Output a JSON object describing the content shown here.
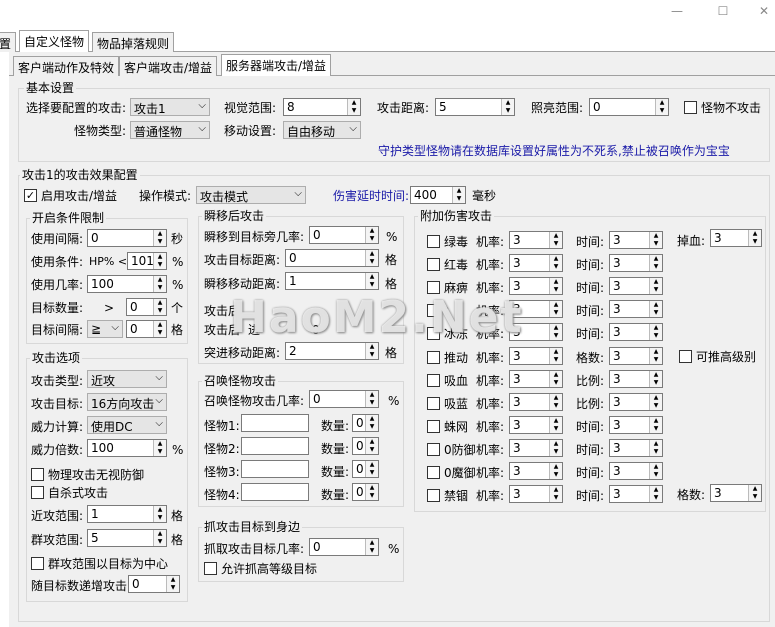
{
  "window": {
    "minimize": "—",
    "maximize": "☐",
    "close": "✕"
  },
  "top_tabs": [
    "置",
    "自定义怪物",
    "物品掉落规则"
  ],
  "sub_tabs": [
    "客户端动作及特效",
    "客户端攻击/增益",
    "服务器端攻击/增益"
  ],
  "basic": {
    "title": "基本设置",
    "select_attack_label": "选择要配置的攻击:",
    "select_attack_value": "攻击1",
    "view_range_label": "视觉范围:",
    "view_range_value": "8",
    "attack_dist_label": "攻击距离:",
    "attack_dist_value": "5",
    "light_range_label": "照亮范围:",
    "light_range_value": "0",
    "no_attack_label": "怪物不攻击",
    "monster_type_label": "怪物类型:",
    "monster_type_value": "普通怪物",
    "move_label": "移动设置:",
    "move_value": "自由移动",
    "note": "守护类型怪物请在数据库设置好属性为不死系,禁止被召唤作为宝宝"
  },
  "effect": {
    "title": "攻击1的攻击效果配置",
    "enable_label": "启用攻击/增益",
    "enable_mark": "✓",
    "mode_label": "操作模式:",
    "mode_value": "攻击模式",
    "delay_label": "伤害延时时间:",
    "delay_value": "400",
    "delay_unit": "毫秒"
  },
  "open_cond": {
    "title": "开启条件限制",
    "interval_label": "使用间隔:",
    "interval_value": "0",
    "interval_unit": "秒",
    "cond_label": "使用条件:",
    "cond_mid": "HP% <",
    "cond_value": "101",
    "cond_unit": "%",
    "rate_label": "使用几率:",
    "rate_value": "100",
    "rate_unit": "%",
    "count_label": "目标数量:",
    "count_op": ">",
    "count_value": "0",
    "count_unit": "个",
    "gap_label": "目标间隔:",
    "gap_op": "≧",
    "gap_value": "0",
    "gap_unit": "格"
  },
  "attack_opts": {
    "title": "攻击选项",
    "type_label": "攻击类型:",
    "type_value": "近攻",
    "target_label": "攻击目标:",
    "target_value": "16方向攻击",
    "power_calc_label": "威力计算:",
    "power_calc_value": "使用DC",
    "power_mult_label": "威力倍数:",
    "power_mult_value": "100",
    "power_mult_unit": "%",
    "ignore_def_label": "物理攻击无视防御",
    "suicide_label": "自杀式攻击",
    "near_label": "近攻范围:",
    "near_value": "1",
    "near_unit": "格",
    "group_label": "群攻范围:",
    "group_value": "5",
    "group_unit": "格",
    "center_label": "群攻范围以目标为中心",
    "inc_label": "随目标数递增攻击:",
    "inc_value": "0"
  },
  "teleport": {
    "title": "瞬移后攻击",
    "rate_label": "瞬移到目标旁几率:",
    "rate_value": "0",
    "rate_unit": "%",
    "dist_label": "攻击目标距离:",
    "dist_value": "0",
    "dist_unit": "格",
    "move_label": "瞬移移动距离:",
    "move_value": "1",
    "move_unit": "格"
  },
  "after": {
    "label1": "攻击后",
    "label2": "攻击后",
    "label2b": "进",
    "value2": "0",
    "rush_label": "突进移动距离:",
    "rush_value": "2",
    "rush_unit": "格"
  },
  "summon": {
    "title": "召唤怪物攻击",
    "rate_label": "召唤怪物攻击几率:",
    "rate_value": "0",
    "rate_unit": "%",
    "m1": "怪物1:",
    "m2": "怪物2:",
    "m3": "怪物3:",
    "m4": "怪物4:",
    "qty_label": "数量:",
    "q1": "0",
    "q2": "0",
    "q3": "0",
    "q4": "0"
  },
  "grab": {
    "title": "抓攻击目标到身边",
    "rate_label": "抓取攻击目标几率:",
    "rate_value": "0",
    "rate_unit": "%",
    "allow_label": "允许抓高等级目标"
  },
  "extra": {
    "title": "附加伤害攻击",
    "rows": [
      {
        "name": "绿毒",
        "rate_label": "机率:",
        "rate": "3",
        "k2": "时间:",
        "v2": "3"
      },
      {
        "name": "红毒",
        "rate_label": "机率:",
        "rate": "3",
        "k2": "时间:",
        "v2": "3"
      },
      {
        "name": "麻痹",
        "rate_label": "机率:",
        "rate": "3",
        "k2": "时间:",
        "v2": "3"
      },
      {
        "name": "冫",
        "rate_label": "机率:",
        "rate": "3",
        "k2": "时间:",
        "v2": "3"
      },
      {
        "name": "冰冻",
        "rate_label": "机率:",
        "rate": "3",
        "k2": "时间:",
        "v2": "3"
      },
      {
        "name": "推动",
        "rate_label": "机率:",
        "rate": "3",
        "k2": "格数:",
        "v2": "3"
      },
      {
        "name": "吸血",
        "rate_label": "机率:",
        "rate": "3",
        "k2": "比例:",
        "v2": "3"
      },
      {
        "name": "吸蓝",
        "rate_label": "机率:",
        "rate": "3",
        "k2": "比例:",
        "v2": "3"
      },
      {
        "name": "蛛网",
        "rate_label": "机率:",
        "rate": "3",
        "k2": "时间:",
        "v2": "3"
      },
      {
        "name": "0防御",
        "rate_label": "机率:",
        "rate": "3",
        "k2": "时间:",
        "v2": "3"
      },
      {
        "name": "0魔御",
        "rate_label": "机率:",
        "rate": "3",
        "k2": "时间:",
        "v2": "3"
      },
      {
        "name": "禁锢",
        "rate_label": "机率:",
        "rate": "3",
        "k2": "时间:",
        "v2": "3"
      }
    ],
    "blood_label": "掉血:",
    "blood_value": "3",
    "push_high_label": "可推高级别",
    "grid_label": "格数:",
    "grid_value": "3"
  },
  "watermark": "HaoM2.Net"
}
